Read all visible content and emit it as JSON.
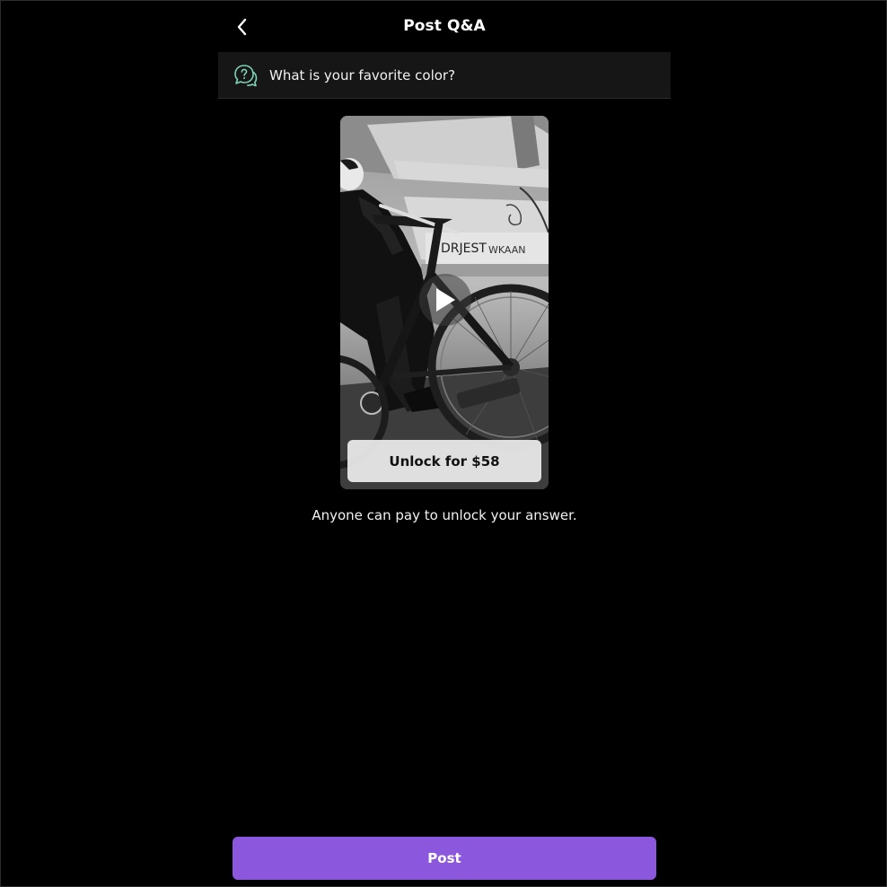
{
  "header": {
    "title": "Post Q&A",
    "back_icon": "chevron-left-icon"
  },
  "question": {
    "icon": "question-bubble-icon",
    "icon_color": "#7fd4b8",
    "text": "What is your favorite color?"
  },
  "video": {
    "thumbnail": "black-and-white photo of a person standing with a BMX bike under a graffiti-covered ramp",
    "play_icon": "play-icon",
    "unlock_label": "Unlock for $58"
  },
  "caption": "Anyone can pay to unlock your answer.",
  "footer": {
    "post_label": "Post",
    "post_color": "#8b57dd"
  }
}
